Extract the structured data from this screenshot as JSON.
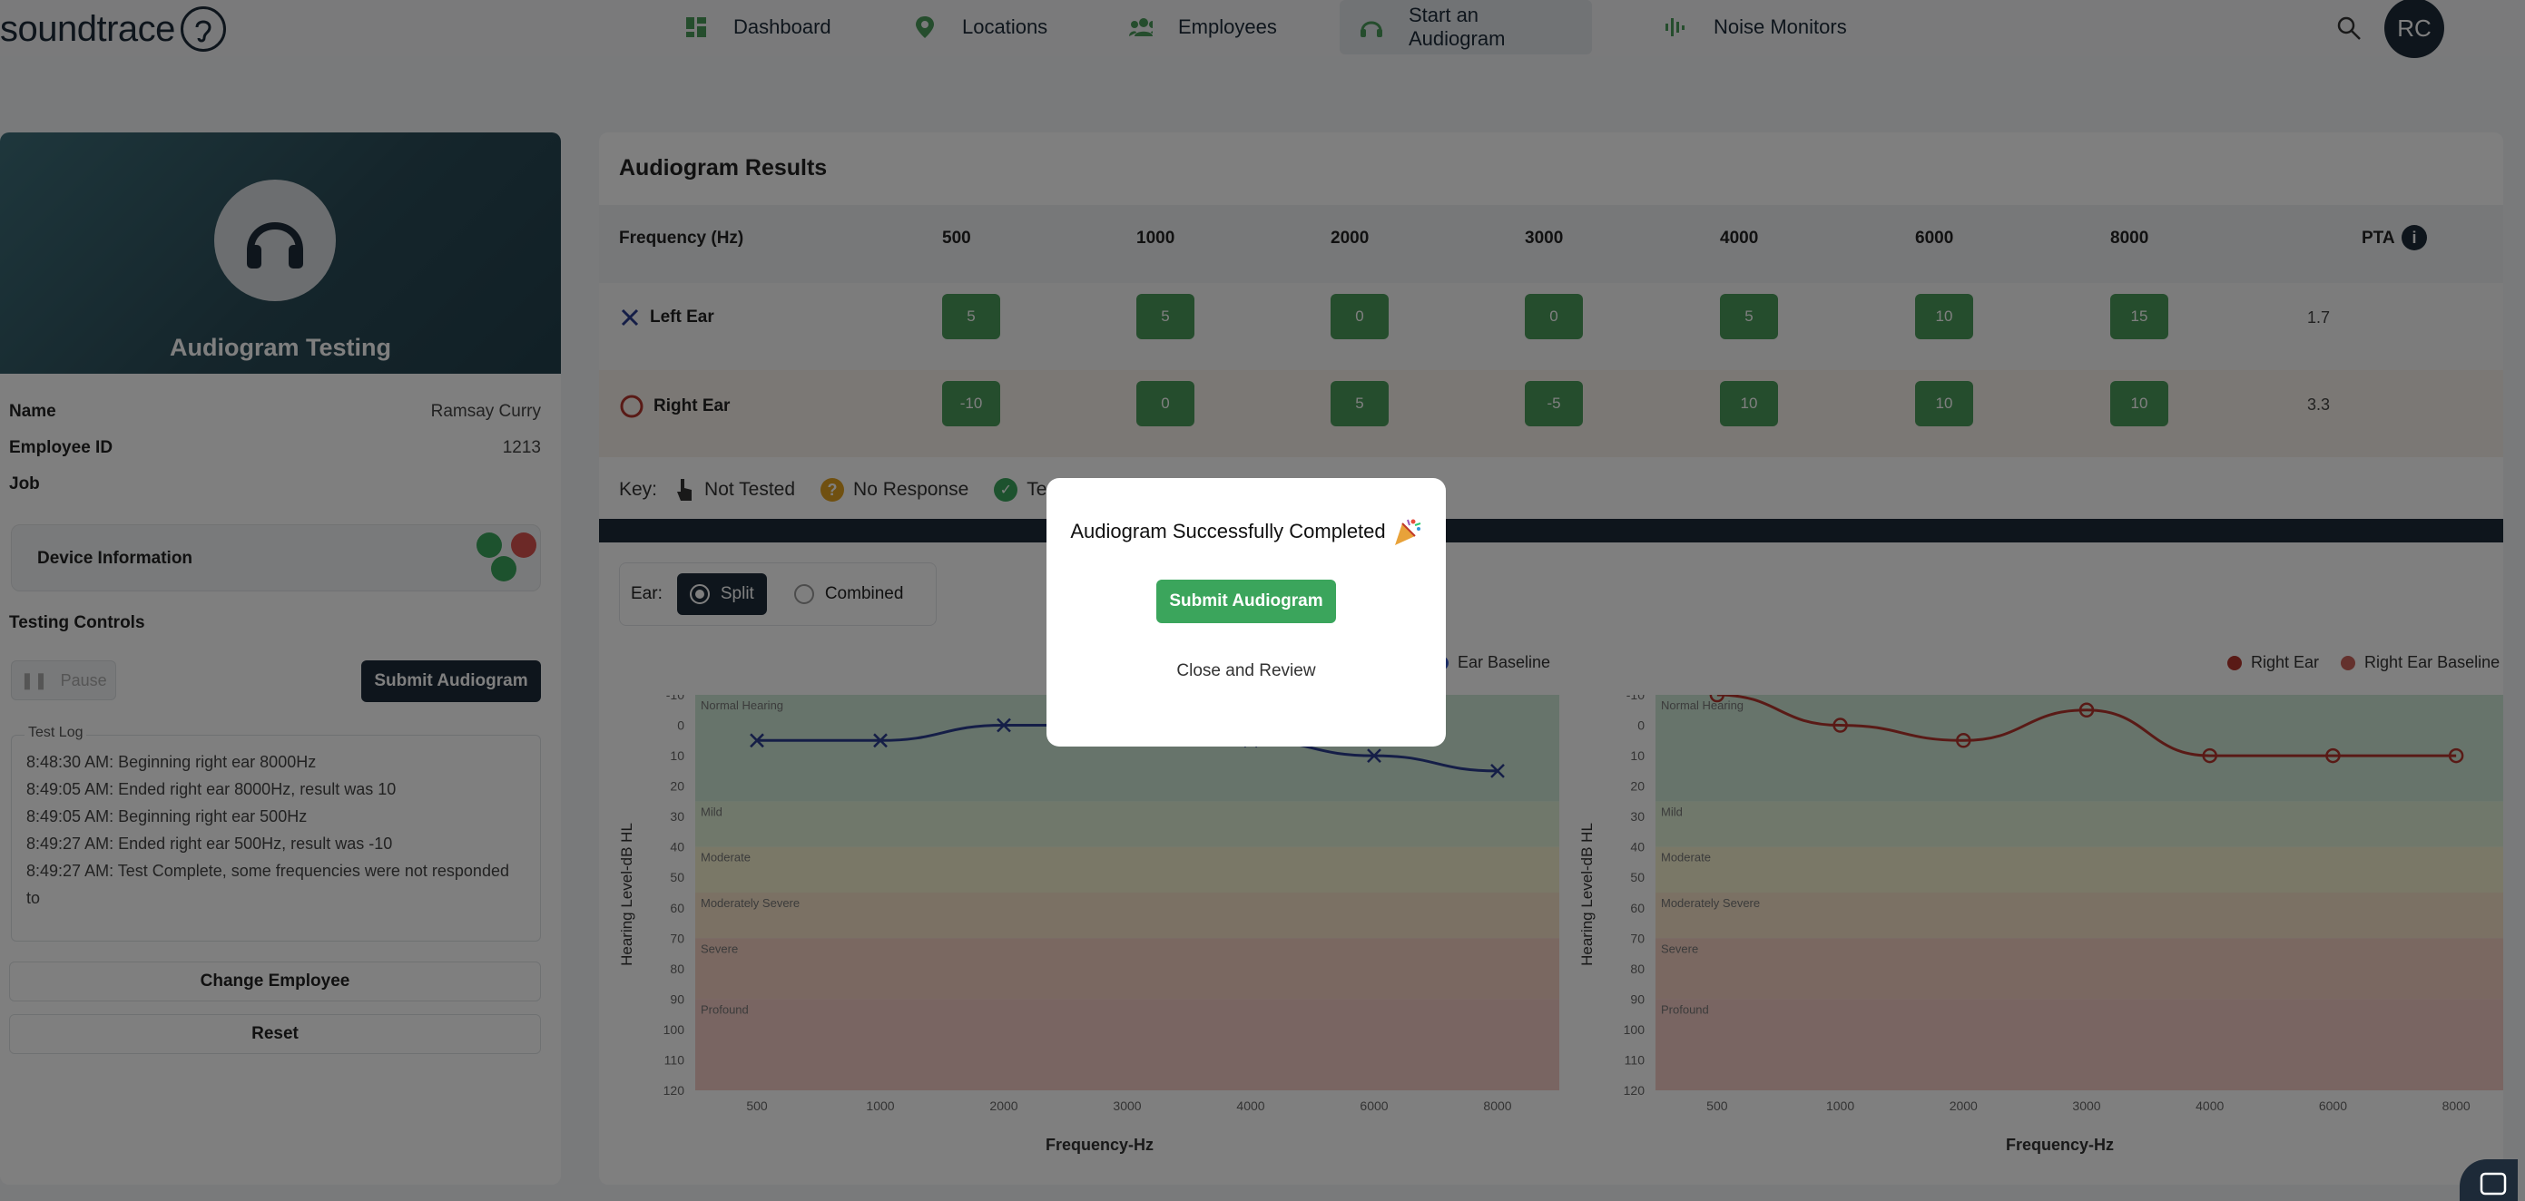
{
  "app": {
    "logo_text": "soundtrace"
  },
  "nav": {
    "items": [
      {
        "label": "Dashboard",
        "icon": "dashboard-icon"
      },
      {
        "label": "Locations",
        "icon": "location-pin-icon"
      },
      {
        "label": "Employees",
        "icon": "people-icon"
      },
      {
        "label": "Start an Audiogram",
        "icon": "headphones-icon",
        "active": true
      },
      {
        "label": "Noise Monitors",
        "icon": "soundwave-icon"
      }
    ],
    "avatar_initials": "RC"
  },
  "sidebar": {
    "hero_title": "Audiogram Testing",
    "name_label": "Name",
    "name_value": "Ramsay Curry",
    "employee_id_label": "Employee ID",
    "employee_id_value": "1213",
    "job_label": "Job",
    "device_label": "Device Information",
    "testing_controls_label": "Testing Controls",
    "pause_label": "Pause",
    "submit_label": "Submit Audiogram",
    "test_log_label": "Test Log",
    "test_log": [
      "8:48:30 AM: Beginning right ear 8000Hz",
      "8:49:05 AM: Ended right ear 8000Hz, result was 10",
      "8:49:05 AM: Beginning right ear 500Hz",
      "8:49:27 AM: Ended right ear 500Hz, result was -10",
      "8:49:27 AM: Test Complete, some frequencies were not responded to"
    ],
    "change_employee_label": "Change Employee",
    "reset_label": "Reset"
  },
  "results": {
    "title": "Audiogram Results",
    "frequency_header": "Frequency (Hz)",
    "frequencies": [
      "500",
      "1000",
      "2000",
      "3000",
      "4000",
      "6000",
      "8000"
    ],
    "pta_header": "PTA",
    "left_ear": {
      "label": "Left Ear",
      "values": [
        "5",
        "5",
        "0",
        "0",
        "5",
        "10",
        "15"
      ],
      "pta": "1.7"
    },
    "right_ear": {
      "label": "Right Ear",
      "values": [
        "-10",
        "0",
        "5",
        "-5",
        "10",
        "10",
        "10"
      ],
      "pta": "3.3"
    },
    "key_label": "Key:",
    "key_not_tested": "Not Tested",
    "key_no_response": "No Response",
    "key_tested": "Tested"
  },
  "ear_toggle": {
    "label": "Ear:",
    "split": "Split",
    "combined": "Combined"
  },
  "charts": {
    "left_legend_baseline": "Ear Baseline",
    "right_legend_ear": "Right Ear",
    "right_legend_baseline": "Right Ear Baseline",
    "y_title": "Hearing Level-dB HL",
    "x_title": "Frequency-Hz",
    "bands": [
      "Normal Hearing",
      "Mild",
      "Moderate",
      "Moderately Severe",
      "Severe",
      "Profound"
    ]
  },
  "chart_data": [
    {
      "type": "line",
      "x": [
        "500",
        "1000",
        "2000",
        "3000",
        "4000",
        "6000",
        "8000"
      ],
      "series": [
        {
          "name": "Left Ear",
          "values": [
            5,
            5,
            0,
            0,
            5,
            10,
            15
          ],
          "color": "#2a3d8f"
        }
      ],
      "xlabel": "Frequency-Hz",
      "ylabel": "Hearing Level-dB HL",
      "ylim": [
        -10,
        120
      ],
      "y_ticks": [
        -10,
        0,
        10,
        20,
        30,
        40,
        50,
        60,
        70,
        80,
        90,
        100,
        110,
        120
      ],
      "y_inverted": true
    },
    {
      "type": "line",
      "x": [
        "500",
        "1000",
        "2000",
        "3000",
        "4000",
        "6000",
        "8000"
      ],
      "series": [
        {
          "name": "Right Ear",
          "values": [
            -10,
            0,
            5,
            -5,
            10,
            10,
            10
          ],
          "color": "#b3342c"
        }
      ],
      "xlabel": "Frequency-Hz",
      "ylabel": "Hearing Level-dB HL",
      "ylim": [
        -10,
        120
      ],
      "y_ticks": [
        -10,
        0,
        10,
        20,
        30,
        40,
        50,
        60,
        70,
        80,
        90,
        100,
        110,
        120
      ],
      "y_inverted": true
    }
  ],
  "modal": {
    "title": "Audiogram Successfully Completed",
    "submit_label": "Submit Audiogram",
    "close_label": "Close and Review"
  },
  "colors": {
    "brand_dark": "#1d2a38",
    "green": "#4a9a5a",
    "left_ear": "#2a3d8f",
    "right_ear": "#b3342c"
  }
}
